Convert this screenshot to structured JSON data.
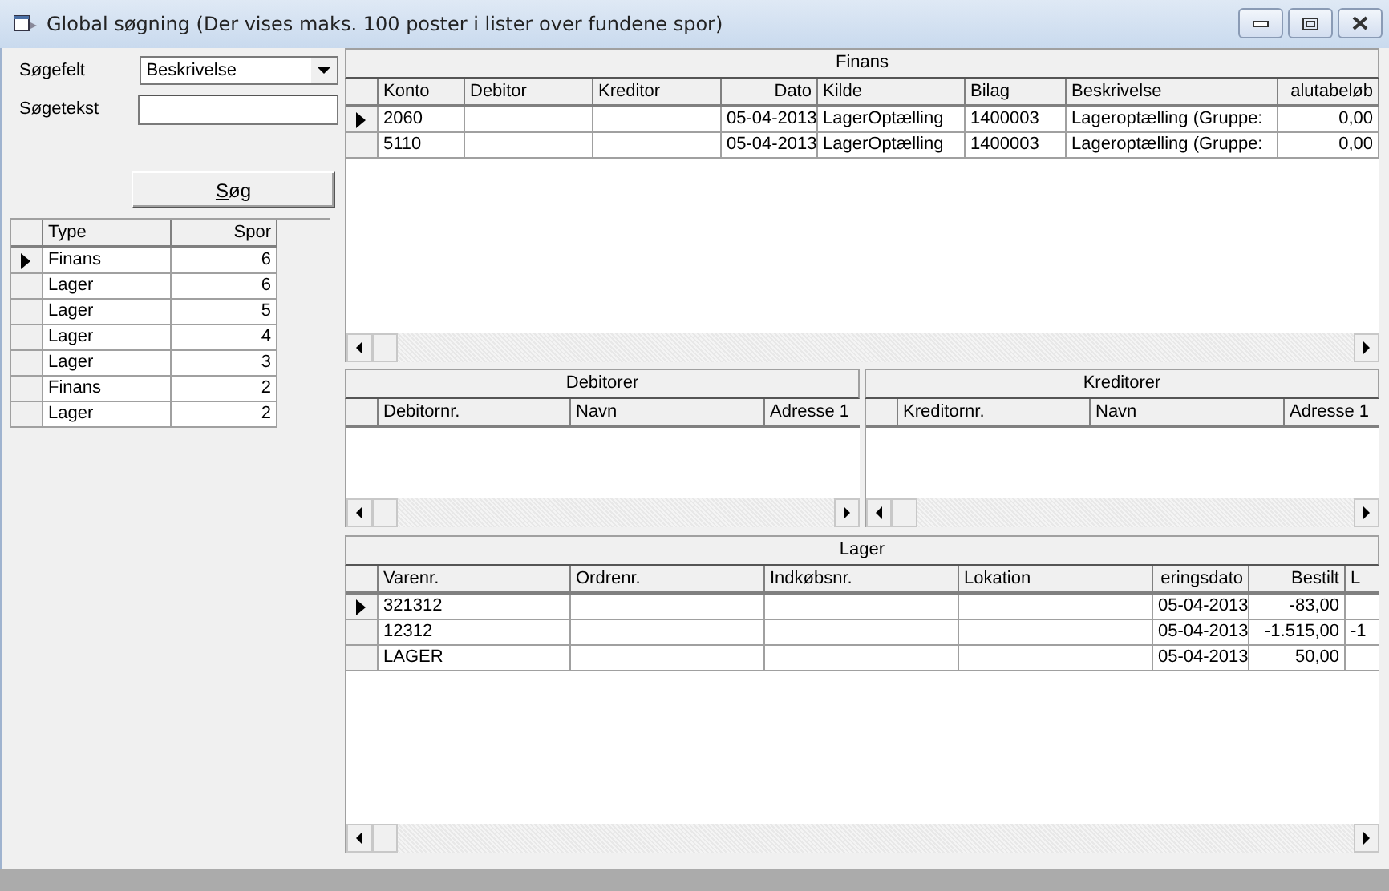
{
  "window": {
    "title": "Global søgning (Der vises maks. 100 poster i lister over fundene spor)"
  },
  "search": {
    "field_label": "Søgefelt",
    "field_value": "Beskrivelse",
    "text_label": "Søgetekst",
    "button": "Søg"
  },
  "results": {
    "columns": [
      "Type",
      "Spor"
    ],
    "rows": [
      {
        "selected": true,
        "cells": [
          "Finans",
          "6"
        ]
      },
      {
        "selected": false,
        "cells": [
          "Lager",
          "6"
        ]
      },
      {
        "selected": false,
        "cells": [
          "Lager",
          "5"
        ]
      },
      {
        "selected": false,
        "cells": [
          "Lager",
          "4"
        ]
      },
      {
        "selected": false,
        "cells": [
          "Lager",
          "3"
        ]
      },
      {
        "selected": false,
        "cells": [
          "Finans",
          "2"
        ]
      },
      {
        "selected": false,
        "cells": [
          "Lager",
          "2"
        ]
      }
    ]
  },
  "finans": {
    "title": "Finans",
    "columns": [
      "Konto",
      "Debitor",
      "Kreditor",
      "Dato",
      "Kilde",
      "Bilag",
      "Beskrivelse",
      "alutabeløb"
    ],
    "rows": [
      {
        "selected": true,
        "cells": [
          "2060",
          "",
          "",
          "05-04-2013",
          "LagerOptælling",
          "1400003",
          "Lageroptælling (Gruppe:",
          "0,00"
        ]
      },
      {
        "selected": false,
        "cells": [
          "5110",
          "",
          "",
          "05-04-2013",
          "LagerOptælling",
          "1400003",
          "Lageroptælling (Gruppe:",
          "0,00"
        ]
      }
    ]
  },
  "debitorer": {
    "title": "Debitorer",
    "columns": [
      "Debitornr.",
      "Navn",
      "Adresse 1"
    ]
  },
  "kreditorer": {
    "title": "Kreditorer",
    "columns": [
      "Kreditornr.",
      "Navn",
      "Adresse 1"
    ]
  },
  "lager": {
    "title": "Lager",
    "columns": [
      "Varenr.",
      "Ordrenr.",
      "Indkøbsnr.",
      "Lokation",
      "eringsdato",
      "Bestilt",
      "L"
    ],
    "rows": [
      {
        "selected": true,
        "cells": [
          "321312",
          "",
          "",
          "",
          "05-04-2013",
          "-83,00",
          ""
        ]
      },
      {
        "selected": false,
        "cells": [
          "12312",
          "",
          "",
          "",
          "05-04-2013",
          "-1.515,00",
          "-1"
        ]
      },
      {
        "selected": false,
        "cells": [
          "LAGER",
          "",
          "",
          "",
          "05-04-2013",
          "50,00",
          ""
        ]
      }
    ]
  }
}
